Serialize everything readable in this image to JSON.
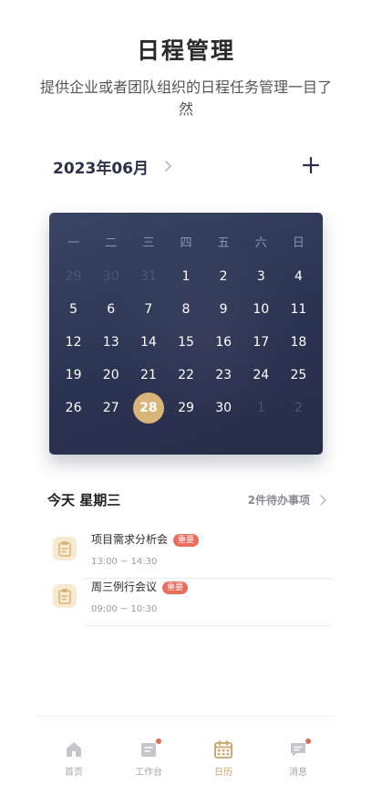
{
  "hero": {
    "title": "日程管理",
    "subtitle": "提供企业或者团队组织的日程任务管理一目了然"
  },
  "calendar": {
    "month_label": "2023年06月",
    "weekdays": [
      "一",
      "二",
      "三",
      "四",
      "五",
      "六",
      "日"
    ],
    "weeks": [
      [
        {
          "d": "29",
          "muted": true
        },
        {
          "d": "30",
          "muted": true
        },
        {
          "d": "31",
          "muted": true
        },
        {
          "d": "1"
        },
        {
          "d": "2"
        },
        {
          "d": "3"
        },
        {
          "d": "4"
        }
      ],
      [
        {
          "d": "5"
        },
        {
          "d": "6"
        },
        {
          "d": "7"
        },
        {
          "d": "8"
        },
        {
          "d": "9"
        },
        {
          "d": "10"
        },
        {
          "d": "11"
        }
      ],
      [
        {
          "d": "12"
        },
        {
          "d": "13"
        },
        {
          "d": "14"
        },
        {
          "d": "15"
        },
        {
          "d": "16"
        },
        {
          "d": "17"
        },
        {
          "d": "18"
        }
      ],
      [
        {
          "d": "19"
        },
        {
          "d": "20"
        },
        {
          "d": "21"
        },
        {
          "d": "22"
        },
        {
          "d": "23"
        },
        {
          "d": "24"
        },
        {
          "d": "25"
        }
      ],
      [
        {
          "d": "26"
        },
        {
          "d": "27"
        },
        {
          "d": "28",
          "selected": true
        },
        {
          "d": "29"
        },
        {
          "d": "30"
        },
        {
          "d": "1",
          "muted": true
        },
        {
          "d": "2",
          "muted": true
        }
      ]
    ],
    "accent_color": "#d9b57a",
    "background_color": "#2b3352"
  },
  "today": {
    "label": "今天 星期三",
    "todo_count": "2件待办事项"
  },
  "tasks": [
    {
      "title": "项目需求分析会",
      "badge": "重要",
      "time": "13:00 ~ 14:30",
      "icon": "clipboard-icon"
    },
    {
      "title": "周三例行会议",
      "badge": "重要",
      "time": "09:00 ~ 10:30",
      "icon": "clipboard-icon"
    }
  ],
  "tabbar": {
    "items": [
      {
        "label": "首页",
        "icon": "home-icon",
        "dot": false,
        "active": false
      },
      {
        "label": "工作台",
        "icon": "workbench-icon",
        "dot": true,
        "active": false
      },
      {
        "label": "日历",
        "icon": "calendar-icon",
        "dot": false,
        "active": true
      },
      {
        "label": "消息",
        "icon": "message-icon",
        "dot": true,
        "active": false
      }
    ],
    "active_color": "#c9a369",
    "inactive_color": "#a2a5ad"
  }
}
